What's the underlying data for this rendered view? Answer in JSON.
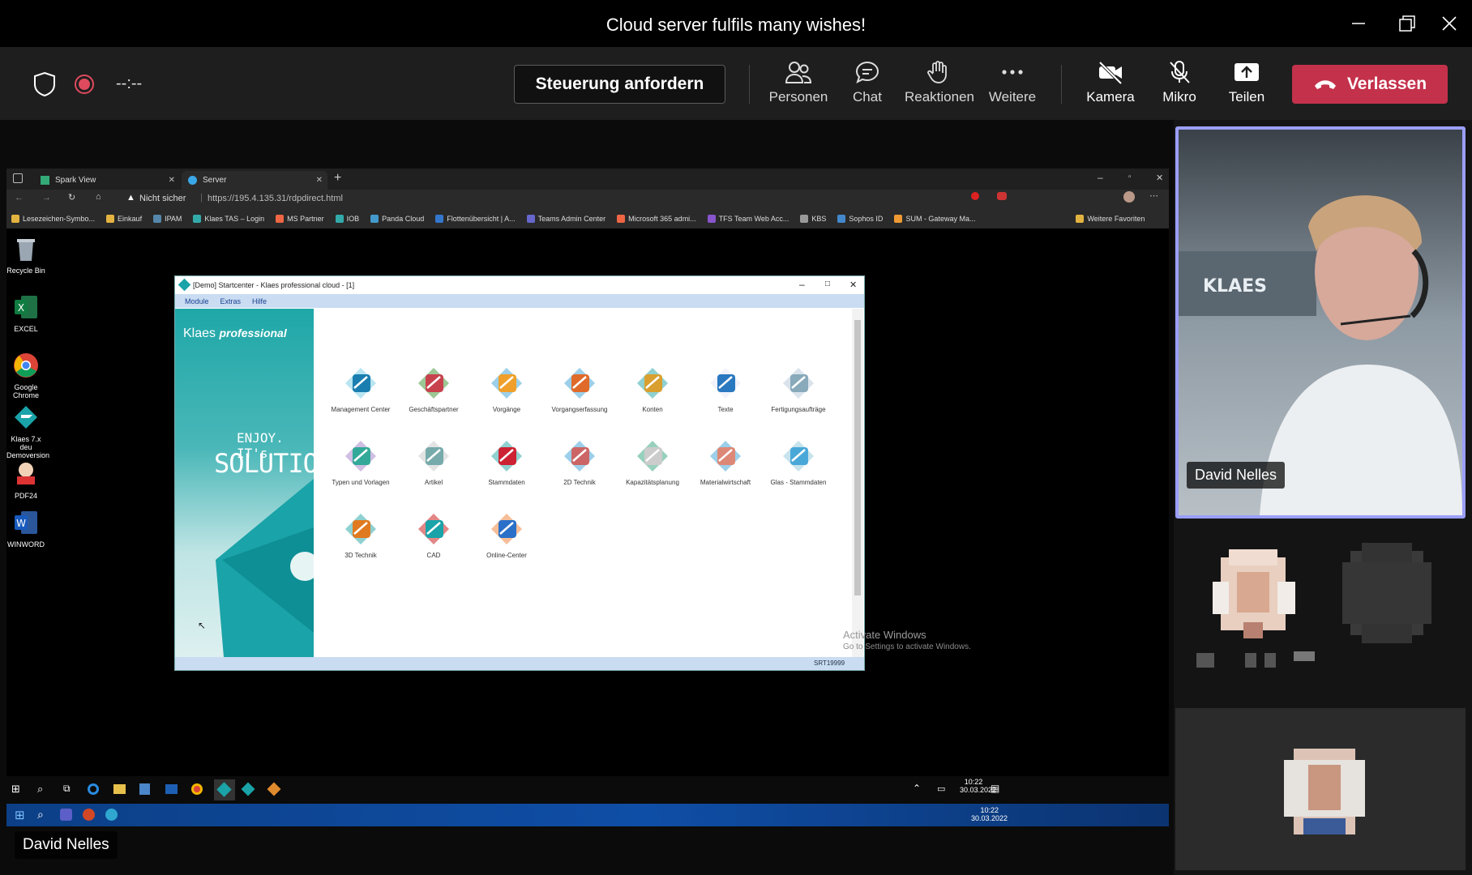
{
  "window": {
    "title": "Cloud server fulfils many wishes!"
  },
  "toolbar": {
    "timer": "--:--",
    "request_control": "Steuerung anfordern",
    "people": "Personen",
    "chat": "Chat",
    "reactions": "Reaktionen",
    "more": "Weitere",
    "camera": "Kamera",
    "mic": "Mikro",
    "share": "Teilen",
    "leave": "Verlassen"
  },
  "browser": {
    "tabs": [
      {
        "label": "Spark View"
      },
      {
        "label": "Server"
      }
    ],
    "security": "Nicht sicher",
    "url": "https://195.4.135.31/rdpdirect.html",
    "favorites": [
      "Lesezeichen-Symbo...",
      "Einkauf",
      "IPAM",
      "Klaes TAS – Login",
      "MS Partner",
      "IOB",
      "Panda Cloud",
      "Flottenübersicht | A...",
      "Teams Admin Center",
      "Microsoft 365 admi...",
      "TFS Team Web Acc...",
      "KBS",
      "Sophos ID",
      "SUM - Gateway Ma..."
    ],
    "more_favorites": "Weitere Favoriten"
  },
  "desktop": {
    "icons": [
      {
        "label": "Recycle Bin"
      },
      {
        "label": "EXCEL"
      },
      {
        "label": "Google Chrome"
      },
      {
        "label": "Klaes 7.x deu Demoversion"
      },
      {
        "label": "PDF24"
      },
      {
        "label": "WINWORD"
      }
    ],
    "watermark_title": "Activate Windows",
    "watermark_sub": "Go to Settings to activate Windows."
  },
  "klaes": {
    "title": "[Demo] Startcenter - Klaes professional cloud - [1]",
    "menu": [
      "Module",
      "Extras",
      "Hilfe"
    ],
    "brand1": "Klaes",
    "brand2": "professional",
    "slogan1": "ENJOY. IT's",
    "slogan2": "SOLUTION",
    "modules": [
      "Management Center",
      "Geschäftspartner",
      "Vorgänge",
      "Vorgangserfassung",
      "Konten",
      "Texte",
      "Fertigungsaufträge",
      "Typen und Vorlagen",
      "Artikel",
      "Stammdaten",
      "2D Technik",
      "Kapazitätsplanung",
      "Materialwirtschaft",
      "Glas - Stammdaten",
      "3D Technik",
      "CAD",
      "Online-Center"
    ],
    "status": "SRT19999"
  },
  "taskbar_remote": {
    "time": "10:22",
    "date": "30.03.2022"
  },
  "taskbar_local": {
    "time": "10:22",
    "date": "30.03.2022"
  },
  "participants": {
    "speaker": "David Nelles",
    "presenter_label": "David Nelles"
  },
  "colors": {
    "leave": "#c4314b",
    "speaker_border": "#9b9ef8",
    "toolbar": "#1e1e1e"
  }
}
